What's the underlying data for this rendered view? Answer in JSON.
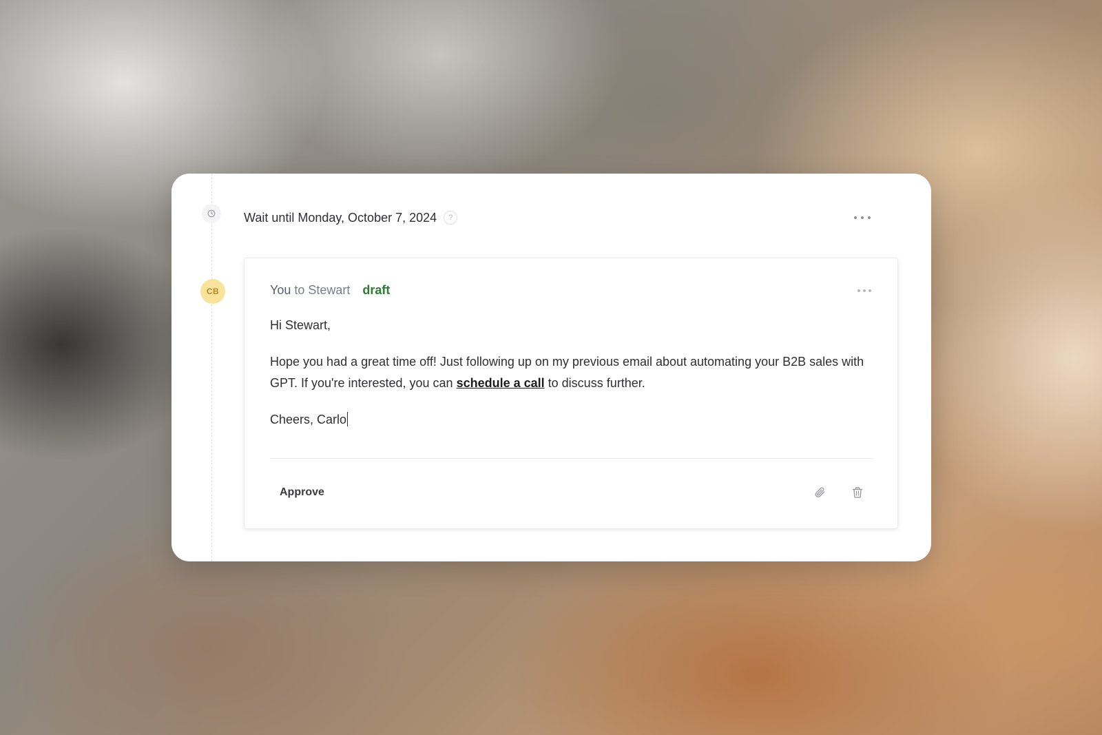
{
  "wait_step": {
    "text": "Wait until Monday, October 7, 2024",
    "help_icon": "?"
  },
  "email": {
    "avatar_initials": "CB",
    "from": "You",
    "to": "to Stewart",
    "status": "draft",
    "body": {
      "greeting": "Hi Stewart,",
      "main_before_link": "Hope you had a great time off! Just following up on my previous email about automating your B2B sales with GPT. If you're interested, you can ",
      "link_text": "schedule a call",
      "main_after_link": " to discuss further.",
      "signoff": "Cheers, Carlo"
    },
    "approve_label": "Approve"
  },
  "icons": {
    "clock": "clock-icon",
    "help": "help-icon",
    "more": "more-horizontal-icon",
    "attach": "paperclip-icon",
    "delete": "trash-icon"
  },
  "colors": {
    "status_draft": "#2e7d32",
    "avatar_bg": "#f9e39a",
    "avatar_text": "#b08a2a"
  }
}
